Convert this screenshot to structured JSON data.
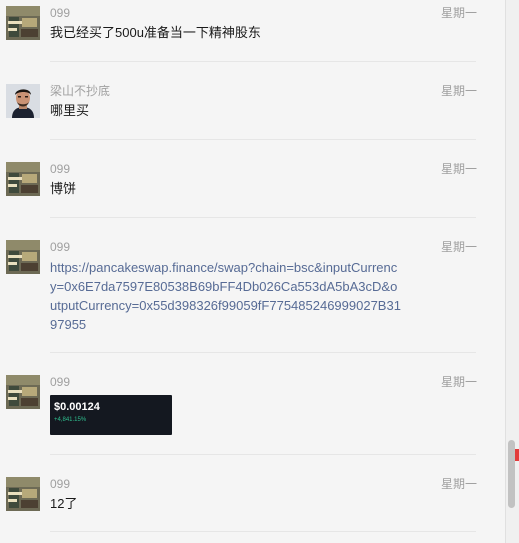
{
  "messages": [
    {
      "sender": "099",
      "time": "星期一",
      "avatar": "thumbnail-avatar",
      "text": "我已经买了500u准备当一下精神股东"
    },
    {
      "sender": "梁山不抄底",
      "time": "星期一",
      "avatar": "portrait-avatar",
      "text": "哪里买"
    },
    {
      "sender": "099",
      "time": "星期一",
      "avatar": "thumbnail-avatar",
      "text": "博饼"
    },
    {
      "sender": "099",
      "time": "星期一",
      "avatar": "thumbnail-avatar",
      "link": "https://pancakeswap.finance/swap?chain=bsc&inputCurrency=0x6E7da7597E80538B69bFF4Db026Ca553dA5bA3cD&outputCurrency=0x55d398326f99059fF775485246999027B3197955"
    },
    {
      "sender": "099",
      "time": "星期一",
      "avatar": "thumbnail-avatar",
      "image": {
        "price": "$0.00124",
        "change": "+4,841.15%"
      }
    },
    {
      "sender": "099",
      "time": "星期一",
      "avatar": "thumbnail-avatar",
      "text": "12了"
    }
  ],
  "colors": {
    "link": "#576b95",
    "meta": "#a0a0a0",
    "background": "#f5f5f5",
    "chart_up": "#2fbf8f"
  }
}
